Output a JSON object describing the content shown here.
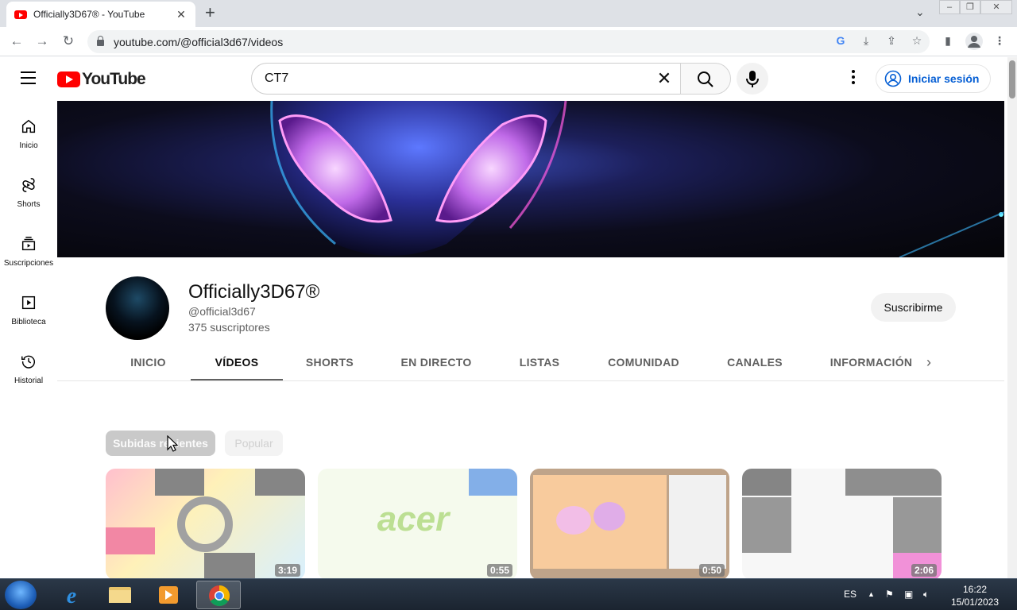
{
  "browser": {
    "tab_title": "Officially3D67® - YouTube",
    "tab_close": "✕",
    "new_tab": "+",
    "url": "youtube.com/@official3d67/videos"
  },
  "header": {
    "logo_text": "YouTube",
    "search_value": "CT7",
    "signin_label": "Iniciar sesión"
  },
  "sidebar": {
    "items": [
      {
        "label": "Inicio",
        "icon": "home-icon"
      },
      {
        "label": "Shorts",
        "icon": "shorts-icon"
      },
      {
        "label": "Suscripciones",
        "icon": "subscriptions-icon"
      },
      {
        "label": "Biblioteca",
        "icon": "library-icon"
      },
      {
        "label": "Historial",
        "icon": "history-icon"
      }
    ]
  },
  "channel": {
    "name": "Officially3D67®",
    "handle": "@official3d67",
    "subscribers": "375 suscriptores",
    "subscribe_label": "Suscribirme"
  },
  "tabs": [
    {
      "label": "INICIO",
      "active": false
    },
    {
      "label": "VÍDEOS",
      "active": true
    },
    {
      "label": "SHORTS",
      "active": false
    },
    {
      "label": "EN DIRECTO",
      "active": false
    },
    {
      "label": "LISTAS",
      "active": false
    },
    {
      "label": "COMUNIDAD",
      "active": false
    },
    {
      "label": "CANALES",
      "active": false
    },
    {
      "label": "INFORMACIÓN",
      "active": false
    }
  ],
  "chips": {
    "recent": "Subidas recientes",
    "popular": "Popular"
  },
  "videos": [
    {
      "duration": "3:19"
    },
    {
      "duration": "0:55"
    },
    {
      "duration": "0:50"
    },
    {
      "duration": "2:06"
    }
  ],
  "taskbar": {
    "language": "ES",
    "time": "16:22",
    "date": "15/01/2023"
  },
  "colors": {
    "youtube_red": "#ff0000",
    "link_blue": "#065fd4"
  }
}
